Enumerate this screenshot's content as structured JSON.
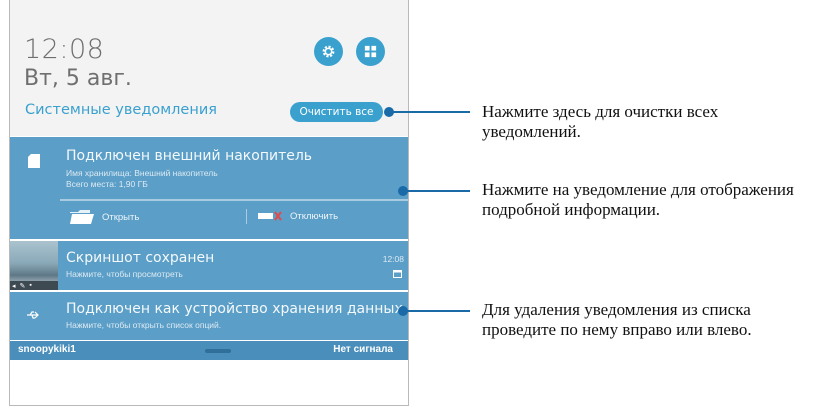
{
  "shade": {
    "time": "12:08",
    "date": "Вт, 5 авг.",
    "section_title": "Системные уведомления",
    "clear_all_label": "Очистить все",
    "settings_icon": "gear-icon",
    "quick_settings_icon": "grid-icon"
  },
  "notifications": [
    {
      "title": "Подключен внешний накопитель",
      "line1": "Имя хранилища: Внешний накопитель",
      "line2": "Всего места: 1,90 ГБ",
      "action_open": "Открыть",
      "action_disconnect": "Отключить"
    },
    {
      "title": "Скриншот сохранен",
      "subtitle": "Нажмите, чтобы просмотреть",
      "time": "12:08"
    },
    {
      "title": "Подключен как устройство хранения данных",
      "subtitle": "Нажмите, чтобы открыть список опций."
    }
  ],
  "status_bar": {
    "operator": "snoopykiki1",
    "signal": "Нет сигнала"
  },
  "callouts": [
    "Нажмите здесь для очистки всех уведомлений.",
    "Нажмите на уведомление для отображения подробной информации.",
    "Для удаления уведомления из списка проведите по нему вправо или влево."
  ],
  "colors": {
    "accent": "#3aa1cf",
    "notification_bg": "#5b9ec7",
    "callout_line": "#1a6aa7"
  }
}
